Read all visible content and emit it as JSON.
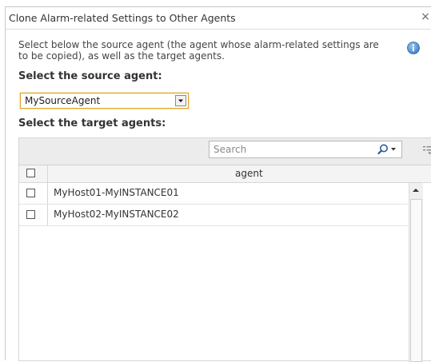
{
  "dialog": {
    "title": "Clone Alarm-related Settings to Other Agents",
    "close_glyph": "×",
    "description": "Select below the source agent (the agent whose alarm-related settings are to be copied), as well as the target agents.",
    "source_label": "Select the source agent:",
    "source_value": "MySourceAgent",
    "target_label": "Select the target agents:"
  },
  "grid": {
    "search_placeholder": "Search",
    "column_header": "agent",
    "rows": [
      {
        "label": "MyHost01-MyINSTANCE01",
        "checked": false
      },
      {
        "label": "MyHost02-MyINSTANCE02",
        "checked": false
      }
    ]
  },
  "colors": {
    "select_border": "#e0a020",
    "info_icon": "#4a90d9"
  }
}
